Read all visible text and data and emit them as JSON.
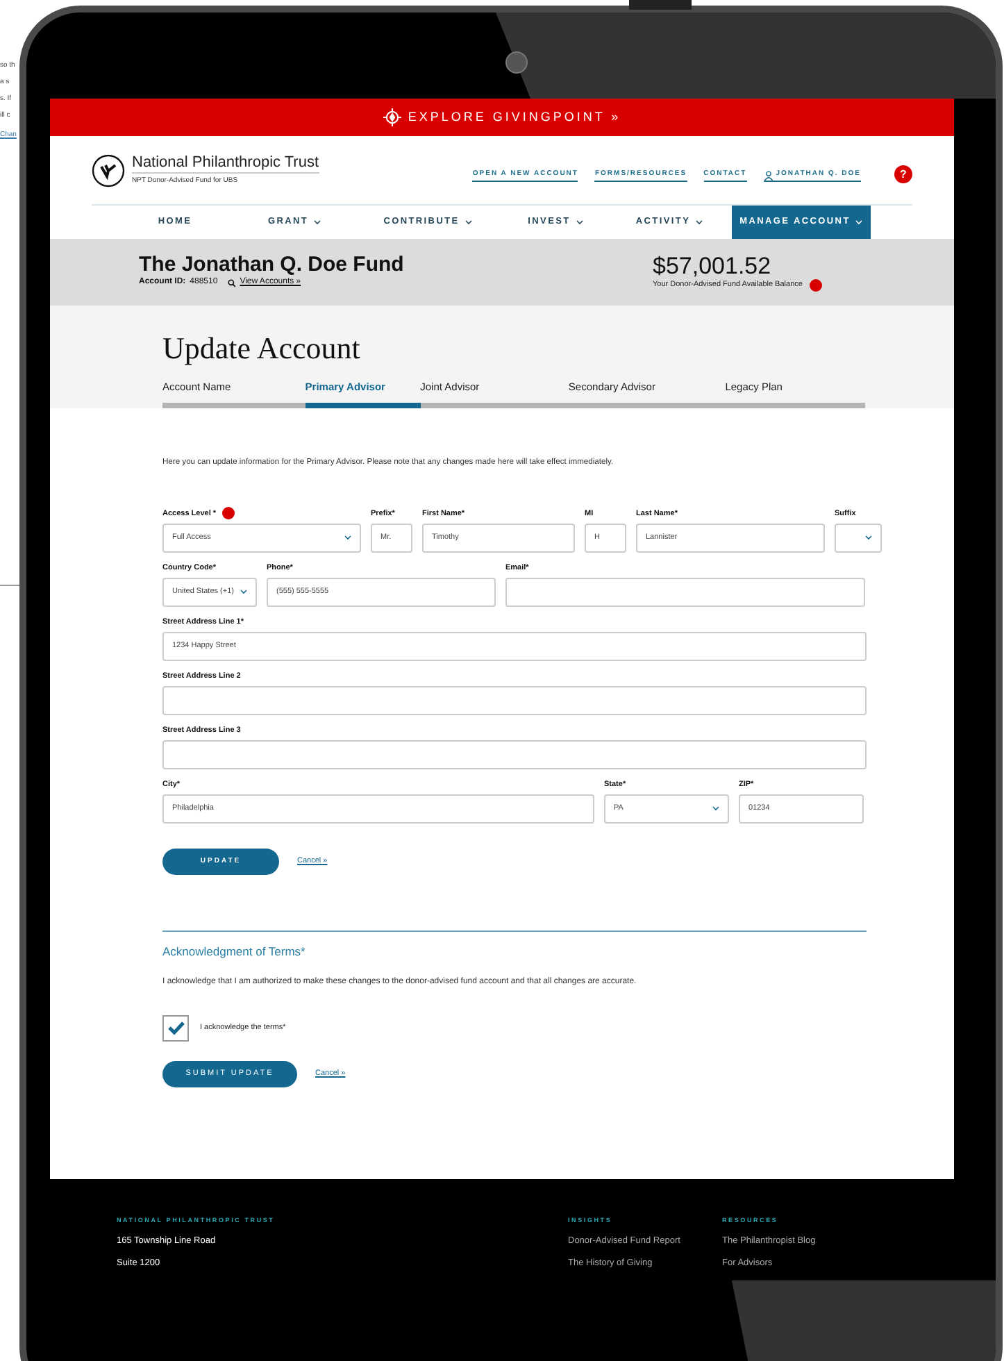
{
  "background_page": {
    "fragments": [
      "so th",
      "a s",
      "s. If",
      "ill c"
    ],
    "link": "Chan"
  },
  "banner": {
    "text": "EXPLORE GIVINGPOINT »"
  },
  "header": {
    "brand": "National Philanthropic Trust",
    "subtitle": "NPT Donor-Advised Fund for UBS",
    "links": [
      "OPEN A NEW ACCOUNT",
      "FORMS/RESOURCES",
      "CONTACT"
    ],
    "user": "JONATHAN Q. DOE",
    "help": "?"
  },
  "nav": [
    {
      "label": "HOME",
      "dropdown": false,
      "selected": false
    },
    {
      "label": "GRANT",
      "dropdown": true,
      "selected": false
    },
    {
      "label": "CONTRIBUTE",
      "dropdown": true,
      "selected": false
    },
    {
      "label": "INVEST",
      "dropdown": true,
      "selected": false
    },
    {
      "label": "ACTIVITY",
      "dropdown": true,
      "selected": false
    },
    {
      "label": "MANAGE ACCOUNT",
      "dropdown": true,
      "selected": true
    }
  ],
  "account": {
    "fund_name": "The Jonathan Q. Doe Fund",
    "id_label": "Account ID:",
    "id": "488510",
    "view_link": "View Accounts »",
    "balance": "$57,001.52",
    "balance_label": "Your Donor-Advised Fund Available Balance"
  },
  "page_title": "Update Account",
  "tabs": [
    {
      "label": "Account Name",
      "selected": false
    },
    {
      "label": "Primary Advisor",
      "selected": true
    },
    {
      "label": "Joint Advisor",
      "selected": false
    },
    {
      "label": "Secondary Advisor",
      "selected": false
    },
    {
      "label": "Legacy Plan",
      "selected": false
    }
  ],
  "intro": "Here you can update information for the Primary Advisor. Please note that any changes made here will take effect immediately.",
  "form_rows": [
    [
      {
        "label": "Access Level *",
        "kind": "select",
        "value": "Full Access",
        "info": true
      },
      {
        "label": "Prefix*",
        "kind": "text",
        "value": "Mr."
      },
      {
        "label": "First Name*",
        "kind": "text",
        "value": "Timothy"
      },
      {
        "label": "MI",
        "kind": "text",
        "value": "H"
      },
      {
        "label": "Last Name*",
        "kind": "text",
        "value": "Lannister"
      },
      {
        "label": "Suffix",
        "kind": "select"
      }
    ],
    [
      {
        "label": "Country Code*",
        "kind": "select",
        "value": "United States (+1)"
      },
      {
        "label": "Phone*",
        "kind": "text",
        "value": "(555) 555-5555"
      },
      {
        "label": "Email*",
        "kind": "text"
      }
    ],
    [
      {
        "label": "Street Address Line 1*",
        "kind": "text",
        "value": "1234 Happy Street"
      }
    ],
    [
      {
        "label": "Street Address Line 2",
        "kind": "text"
      }
    ],
    [
      {
        "label": "Street Address Line 3",
        "kind": "text"
      }
    ],
    [
      {
        "label": "City*",
        "kind": "text",
        "value": "Philadelphia"
      },
      {
        "label": "State*",
        "kind": "select",
        "value": "PA"
      },
      {
        "label": "ZIP*",
        "kind": "text",
        "value": "01234"
      }
    ]
  ],
  "form_actions": {
    "submit": "UPDATE",
    "cancel": "Cancel »"
  },
  "terms": {
    "heading": "Acknowledgment of Terms*",
    "text": "I acknowledge that I am authorized to make these changes to the donor-advised fund account and that all changes are accurate.",
    "checkbox": {
      "label": "I acknowledge the terms*",
      "checked": true
    },
    "submit": "SUBMIT UPDATE",
    "cancel": "Cancel »"
  },
  "footer": [
    {
      "heading": "NATIONAL PHILANTHROPIC TRUST",
      "kind": "address",
      "lines": [
        "165 Township Line Road",
        "Suite 1200"
      ]
    },
    {
      "heading": "INSIGHTS",
      "kind": "links",
      "lines": [
        "Donor-Advised Fund Report",
        "The History of Giving"
      ]
    },
    {
      "heading": "RESOURCES",
      "kind": "links",
      "lines": [
        "The Philanthropist Blog",
        "For Advisors"
      ]
    }
  ]
}
